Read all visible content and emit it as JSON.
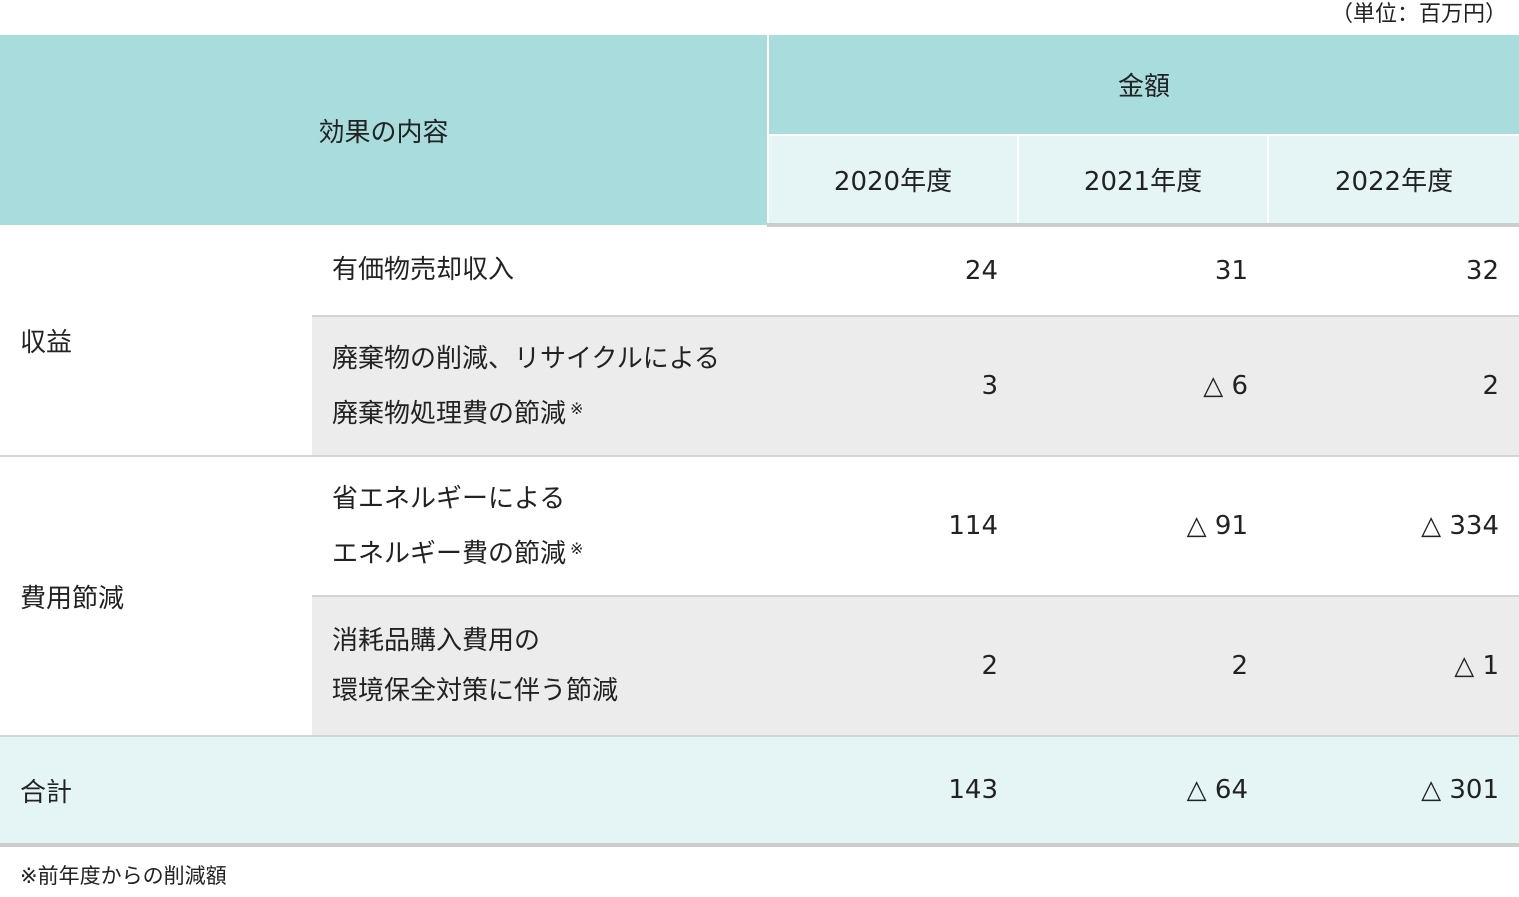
{
  "unit_note": "（単位：百万円）",
  "header": {
    "content_label": "効果の内容",
    "amount_label": "金額",
    "years": [
      "2020年度",
      "2021年度",
      "2022年度"
    ]
  },
  "categories": {
    "revenue": "収益",
    "cost_reduction": "費用節減"
  },
  "rows": [
    {
      "item_line1": "有価物売却収入",
      "item_line2": "",
      "mark": "",
      "values": [
        "24",
        "31",
        "32"
      ]
    },
    {
      "item_line1": "廃棄物の削減、リサイクルによる",
      "item_line2": "廃棄物処理費の節減",
      "mark": "※",
      "values": [
        "3",
        "△ 6",
        "2"
      ]
    },
    {
      "item_line1": "省エネルギーによる",
      "item_line2": "エネルギー費の節減",
      "mark": "※",
      "values": [
        "114",
        "△ 91",
        "△ 334"
      ]
    },
    {
      "item_line1": "消耗品購入費用の",
      "item_line2": "環境保全対策に伴う節減",
      "mark": "",
      "values": [
        "2",
        "2",
        "△ 1"
      ]
    }
  ],
  "total": {
    "label": "合計",
    "values": [
      "143",
      "△ 64",
      "△ 301"
    ]
  },
  "footnote": "※前年度からの削減額"
}
